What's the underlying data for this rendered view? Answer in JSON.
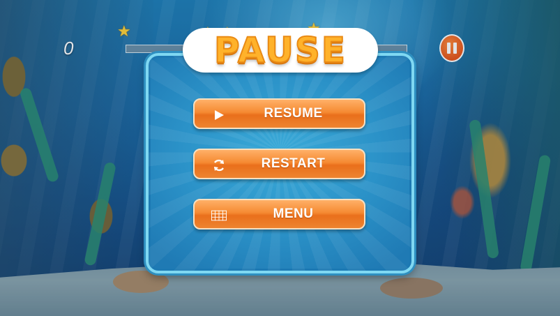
{
  "hud": {
    "score": "0",
    "pause_icon": "pause-icon",
    "star_icon": "star-icon",
    "colors": {
      "pause_button": "#e8561a",
      "star": "#ffd23a"
    }
  },
  "pause_dialog": {
    "title": "PAUSE",
    "buttons": [
      {
        "label": "RESUME",
        "icon": "play-icon"
      },
      {
        "label": "RESTART",
        "icon": "refresh-icon"
      },
      {
        "label": "MENU",
        "icon": "grid-icon"
      }
    ],
    "colors": {
      "title": "#ffb22a",
      "button": "#f58a32",
      "panel": "#2b92c8"
    }
  }
}
